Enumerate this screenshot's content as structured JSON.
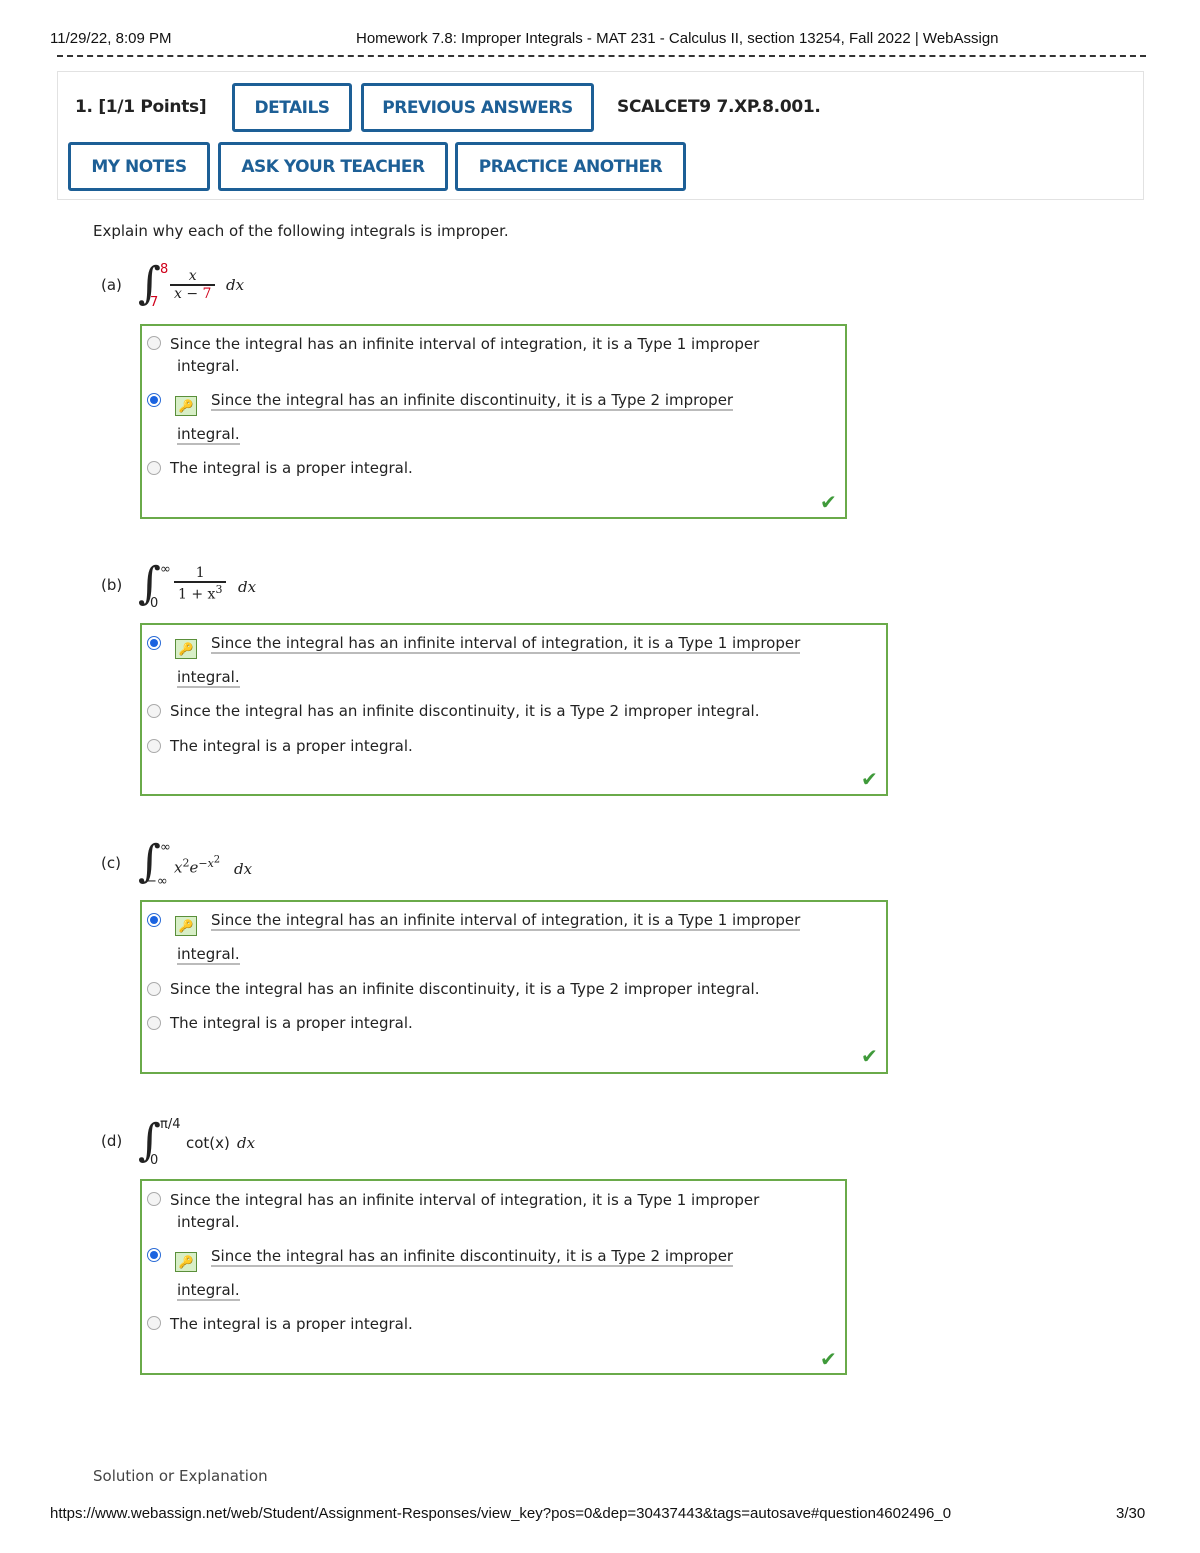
{
  "print_header": {
    "datetime": "11/29/22, 8:09 PM",
    "title": "Homework 7.8: Improper Integrals - MAT 231 - Calculus II, section 13254, Fall 2022 | WebAssign"
  },
  "question": {
    "number_label": "1.",
    "points": "[1/1 Points]",
    "details_button": "DETAILS",
    "previous_answers_button": "PREVIOUS ANSWERS",
    "code": "SCALCET9 7.XP.8.001.",
    "my_notes_button": "MY NOTES",
    "ask_teacher_button": "ASK YOUR TEACHER",
    "practice_another_button": "PRACTICE ANOTHER",
    "prompt": "Explain why each of the following integrals is improper."
  },
  "parts": {
    "a": {
      "label": "(a)",
      "upper": "8",
      "lower": "7",
      "numerator": "x",
      "denominator_prefix": "x − ",
      "denominator_value": "7",
      "dx": "dx",
      "options": [
        "Since the integral has an infinite interval of integration, it is a Type 1 improper integral.",
        "Since the integral has an infinite discontinuity, it is a Type 2 improper integral.",
        "The integral is a proper integral."
      ],
      "opt2_line1": "Since the integral has an infinite discontinuity, it is a Type 2 improper",
      "opt2_line2": "integral.",
      "opt1_line1": "Since the integral has an infinite interval of integration, it is a Type 1 improper",
      "opt1_line2": "integral.",
      "selected": 2
    },
    "b": {
      "label": "(b)",
      "upper": "∞",
      "lower": "0",
      "numerator": "1",
      "denominator": "1 + x",
      "exponent": "3",
      "dx": "dx",
      "opt1_line1": "Since the integral has an infinite interval of integration, it is a Type 1 improper",
      "opt1_line2": "integral.",
      "opt2": "Since the integral has an infinite discontinuity, it is a Type 2 improper integral.",
      "opt3": "The integral is a proper integral.",
      "selected": 1
    },
    "c": {
      "label": "(c)",
      "upper": "∞",
      "lower": "−∞",
      "integrand_x": "x",
      "integrand_x_exp": "2",
      "integrand_e": "e",
      "integrand_e_exp": "−x",
      "integrand_e_exp_exp": "2",
      "dx": "dx",
      "opt1_line1": "Since the integral has an infinite interval of integration, it is a Type 1 improper",
      "opt1_line2": "integral.",
      "opt2": "Since the integral has an infinite discontinuity, it is a Type 2 improper integral.",
      "opt3": "The integral is a proper integral.",
      "selected": 1
    },
    "d": {
      "label": "(d)",
      "upper": "π/4",
      "lower": "0",
      "integrand": "cot(x)",
      "dx": "dx",
      "opt1_line1": "Since the integral has an infinite interval of integration, it is a Type 1 improper",
      "opt1_line2": "integral.",
      "opt2_line1": "Since the integral has an infinite discontinuity, it is a Type 2 improper",
      "opt2_line2": "integral.",
      "opt3": "The integral is a proper integral.",
      "selected": 2
    }
  },
  "solution_label": "Solution or Explanation",
  "footer": {
    "url": "https://www.webassign.net/web/Student/Assignment-Responses/view_key?pos=0&dep=30437443&tags=autosave#question4602496_0",
    "page": "3/30"
  },
  "colors": {
    "button_blue": "#1d5f96",
    "correct_green": "#6aaa4a",
    "answer_red": "#d0021b",
    "radio_blue": "#1b63e0"
  },
  "icons": {
    "answer_key": "key-icon",
    "correct": "checkmark-icon"
  }
}
